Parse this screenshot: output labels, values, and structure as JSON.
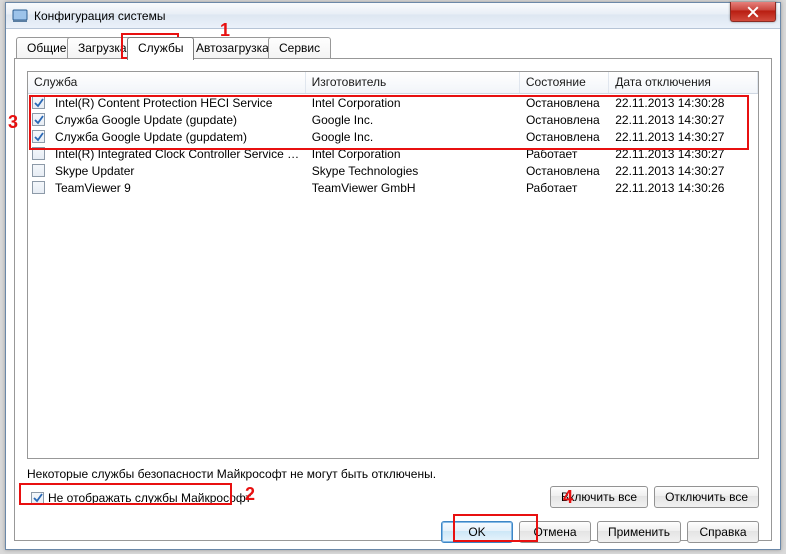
{
  "window": {
    "title": "Конфигурация системы"
  },
  "tabs": {
    "t0": "Общие",
    "t1": "Загрузка",
    "t2": "Службы",
    "t3": "Автозагрузка",
    "t4": "Сервис"
  },
  "columns": {
    "c0": "Служба",
    "c1": "Изготовитель",
    "c2": "Состояние",
    "c3": "Дата отключения"
  },
  "rows": [
    {
      "checked": true,
      "service": "Intel(R) Content Protection HECI Service",
      "vendor": "Intel Corporation",
      "state": "Остановлена",
      "date": "22.11.2013 14:30:28"
    },
    {
      "checked": true,
      "service": "Служба Google Update (gupdate)",
      "vendor": "Google Inc.",
      "state": "Остановлена",
      "date": "22.11.2013 14:30:27"
    },
    {
      "checked": true,
      "service": "Служба Google Update (gupdatem)",
      "vendor": "Google Inc.",
      "state": "Остановлена",
      "date": "22.11.2013 14:30:27"
    },
    {
      "checked": false,
      "service": "Intel(R) Integrated Clock Controller Service - Int...",
      "vendor": "Intel Corporation",
      "state": "Работает",
      "date": "22.11.2013 14:30:27"
    },
    {
      "checked": false,
      "service": "Skype Updater",
      "vendor": "Skype Technologies",
      "state": "Остановлена",
      "date": "22.11.2013 14:30:27"
    },
    {
      "checked": false,
      "service": "TeamViewer 9",
      "vendor": "TeamViewer GmbH",
      "state": "Работает",
      "date": "22.11.2013 14:30:26"
    }
  ],
  "note": "Некоторые службы безопасности Майкрософт не могут быть отключены.",
  "hide_ms": {
    "label": "Не отображать службы Майкрософт",
    "checked": true
  },
  "buttons": {
    "enable_all": "Включить все",
    "disable_all": "Отключить все",
    "ok": "OK",
    "cancel": "Отмена",
    "apply": "Применить",
    "help": "Справка"
  },
  "annotations": {
    "a1": "1",
    "a2": "2",
    "a3": "3",
    "a4": "4"
  }
}
